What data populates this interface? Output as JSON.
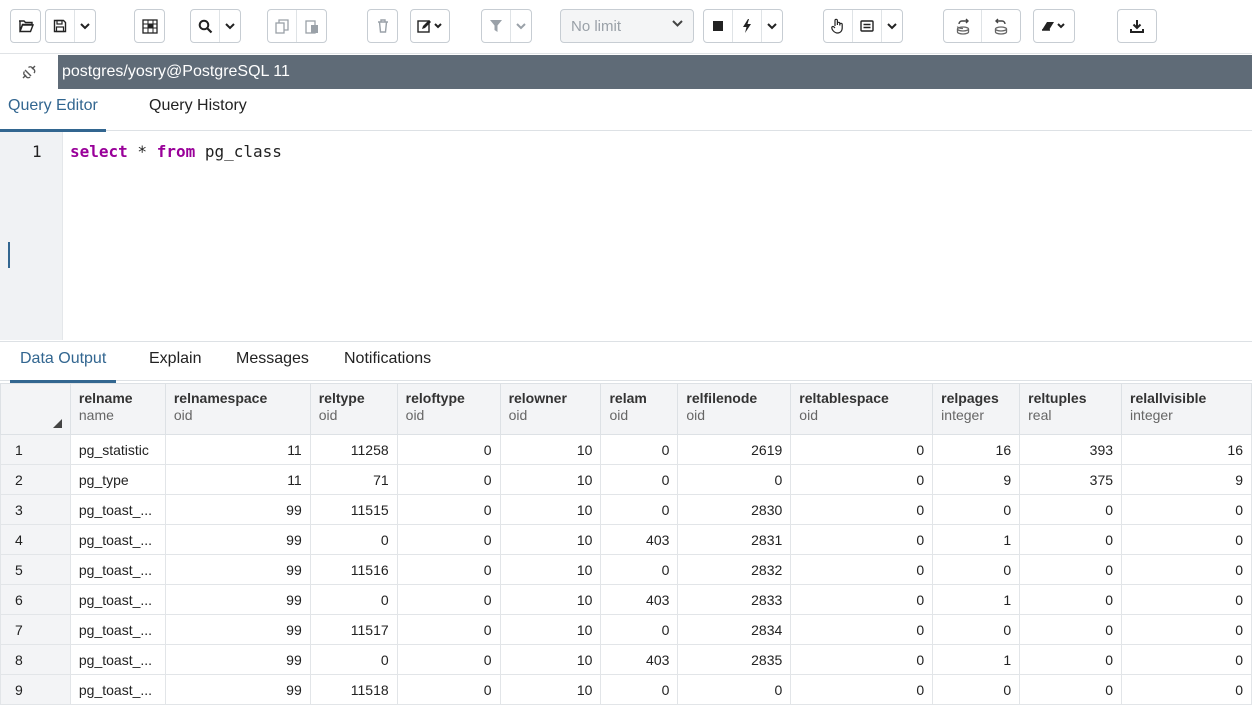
{
  "toolbar": {
    "buttons": [
      {
        "icon": "open-folder-icon"
      },
      {
        "icon": "save-icon"
      },
      {
        "icon": "edit-data-icon"
      },
      {
        "icon": "find-icon"
      },
      {
        "icon": "copy-icon"
      },
      {
        "icon": "paste-icon"
      },
      {
        "icon": "delete-icon"
      },
      {
        "icon": "edit-icon"
      },
      {
        "icon": "filter-icon"
      },
      {
        "icon": "stop-icon"
      },
      {
        "icon": "execute-icon"
      },
      {
        "icon": "explain-icon"
      },
      {
        "icon": "explain-analyze-icon"
      },
      {
        "icon": "commit-icon"
      },
      {
        "icon": "rollback-icon"
      },
      {
        "icon": "clear-icon"
      },
      {
        "icon": "download-icon"
      }
    ],
    "row_limit": "No limit"
  },
  "connection": {
    "title": "postgres/yosry@PostgreSQL 11",
    "icon": "connection-icon"
  },
  "query_tabs": [
    {
      "label": "Query Editor",
      "active": true
    },
    {
      "label": "Query History",
      "active": false
    }
  ],
  "editor": {
    "line_number": "1",
    "tokens": {
      "kw1": "select",
      "mid": " * ",
      "kw2": "from",
      "rest": " pg_class"
    }
  },
  "output_tabs": [
    {
      "label": "Data Output",
      "active": true
    },
    {
      "label": "Explain",
      "active": false
    },
    {
      "label": "Messages",
      "active": false
    },
    {
      "label": "Notifications",
      "active": false
    }
  ],
  "grid": {
    "columns": [
      {
        "name": "relname",
        "type": "name"
      },
      {
        "name": "relnamespace",
        "type": "oid"
      },
      {
        "name": "reltype",
        "type": "oid"
      },
      {
        "name": "reloftype",
        "type": "oid"
      },
      {
        "name": "relowner",
        "type": "oid"
      },
      {
        "name": "relam",
        "type": "oid"
      },
      {
        "name": "relfilenode",
        "type": "oid"
      },
      {
        "name": "reltablespace",
        "type": "oid"
      },
      {
        "name": "relpages",
        "type": "integer"
      },
      {
        "name": "reltuples",
        "type": "real"
      },
      {
        "name": "relallvisible",
        "type": "integer"
      }
    ],
    "rows": [
      {
        "n": "1",
        "cells": [
          "pg_statistic",
          "11",
          "11258",
          "0",
          "10",
          "0",
          "2619",
          "0",
          "16",
          "393",
          "16"
        ]
      },
      {
        "n": "2",
        "cells": [
          "pg_type",
          "11",
          "71",
          "0",
          "10",
          "0",
          "0",
          "0",
          "9",
          "375",
          "9"
        ]
      },
      {
        "n": "3",
        "cells": [
          "pg_toast_...",
          "99",
          "11515",
          "0",
          "10",
          "0",
          "2830",
          "0",
          "0",
          "0",
          "0"
        ]
      },
      {
        "n": "4",
        "cells": [
          "pg_toast_...",
          "99",
          "0",
          "0",
          "10",
          "403",
          "2831",
          "0",
          "1",
          "0",
          "0"
        ]
      },
      {
        "n": "5",
        "cells": [
          "pg_toast_...",
          "99",
          "11516",
          "0",
          "10",
          "0",
          "2832",
          "0",
          "0",
          "0",
          "0"
        ]
      },
      {
        "n": "6",
        "cells": [
          "pg_toast_...",
          "99",
          "0",
          "0",
          "10",
          "403",
          "2833",
          "0",
          "1",
          "0",
          "0"
        ]
      },
      {
        "n": "7",
        "cells": [
          "pg_toast_...",
          "99",
          "11517",
          "0",
          "10",
          "0",
          "2834",
          "0",
          "0",
          "0",
          "0"
        ]
      },
      {
        "n": "8",
        "cells": [
          "pg_toast_...",
          "99",
          "0",
          "0",
          "10",
          "403",
          "2835",
          "0",
          "1",
          "0",
          "0"
        ]
      },
      {
        "n": "9",
        "cells": [
          "pg_toast_...",
          "99",
          "11518",
          "0",
          "10",
          "0",
          "0",
          "0",
          "0",
          "0",
          "0"
        ]
      }
    ]
  }
}
